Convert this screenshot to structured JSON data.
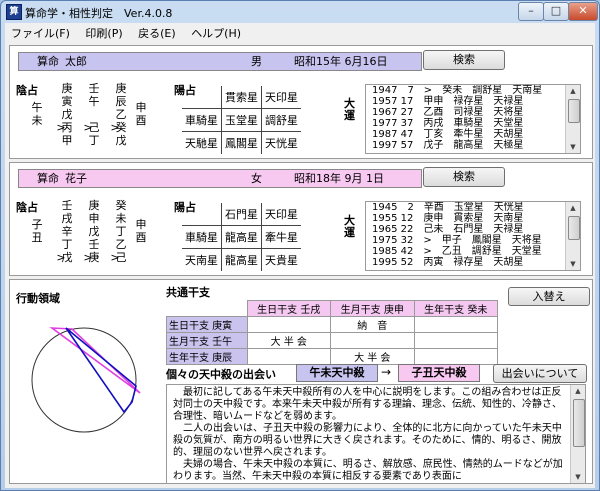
{
  "window": {
    "title": "算命学・相性判定　Ver.4.0.8",
    "icon": "app-icon",
    "controls": {
      "minimize": "–",
      "maximize": "□",
      "close": "✕"
    }
  },
  "menu": [
    "ファイル(F)",
    "印刷(P)",
    "戻る(E)",
    "ヘルプ(H)"
  ],
  "person1": {
    "name_label": "算命",
    "name": "太郎",
    "gender": "男",
    "birth": "昭和15年 6月16日",
    "search_button": "検索",
    "bar_color": "#c8c4f0",
    "inyo_label": "陰占",
    "columns": [
      [
        "庚",
        "寅",
        "戊",
        "丙",
        "甲"
      ],
      [
        "壬",
        "午",
        "",
        "己",
        "丁"
      ],
      [
        "庚",
        "辰",
        "乙",
        "癸",
        "戊"
      ]
    ],
    "left_chars": [
      "午",
      "未"
    ],
    "right_chars": [
      "申",
      "酉"
    ],
    "arrows": [
      ">",
      ">",
      ">"
    ],
    "yosen_label": "陽占",
    "stars": [
      [
        "",
        "貫索星",
        "天印星"
      ],
      [
        "車騎星",
        "玉堂星",
        "調舒星"
      ],
      [
        "天馳星",
        "鳳閣星",
        "天恍星"
      ]
    ],
    "taiun_label": "大運",
    "taiun": [
      "1947　7　>　癸未　調舒星　天南星",
      "1957 17　甲申　禄存星　天禄星",
      "1967 27　乙酉　司禄星　天将星",
      "1977 37　丙戌　車騎星　天堂星",
      "1987 47　丁亥　牽牛星　天胡星",
      "1997 57　戊子　龍高星　天極星"
    ]
  },
  "person2": {
    "name_label": "算命",
    "name": "花子",
    "gender": "女",
    "birth": "昭和18年 9月 1日",
    "search_button": "検索",
    "bar_color": "#f7c8f0",
    "inyo_label": "陰占",
    "columns": [
      [
        "壬",
        "戌",
        "辛",
        "丁",
        "戊"
      ],
      [
        "庚",
        "申",
        "戊",
        "壬",
        "庚"
      ],
      [
        "癸",
        "未",
        "丁",
        "乙",
        "己"
      ]
    ],
    "left_chars": [
      "子",
      "丑"
    ],
    "right_chars": [
      "申",
      "酉"
    ],
    "arrows": [
      ">",
      ">",
      ">"
    ],
    "yosen_label": "陽占",
    "stars": [
      [
        "",
        "石門星",
        "天印星"
      ],
      [
        "車騎星",
        "龍高星",
        "牽牛星"
      ],
      [
        "天南星",
        "龍高星",
        "天貴星"
      ]
    ],
    "taiun_label": "大運",
    "taiun": [
      "1945　2　辛酉　玉堂星　天恍星",
      "1955 12　庚申　貫索星　天南星",
      "1965 22　己未　石門星　天禄星",
      "1975 32　>　甲子　鳳閣星　天将星",
      "1985 42　>　乙丑　調舒星　天堂星",
      "1995 52　丙寅　禄存星　天胡星"
    ]
  },
  "bottom": {
    "kodo_label": "行動領域",
    "kyotsu_label": "共通干支",
    "swap_button": "入替え",
    "table_header": [
      "",
      "生日干支 壬戌",
      "生月干支 庚申",
      "生年干支 癸未"
    ],
    "table_rows": [
      [
        "生日干支 庚寅",
        "",
        "納　音",
        ""
      ],
      [
        "生月干支 壬午",
        "大 半 会",
        "",
        ""
      ],
      [
        "生年干支 庚辰",
        "",
        "大 半 会",
        ""
      ]
    ],
    "tenchu_label": "個々の天中殺の出会い",
    "tenchu_a": "午未天中殺",
    "tenchu_arrow": "→",
    "tenchu_b": "子丑天中殺",
    "tenchu_a_color": "#c8c4f0",
    "tenchu_b_color": "#f7c8f0",
    "about_button": "出会いについて",
    "text": "　最初に記してある午未天中殺所有の人を中心に説明をします。この組み合わせは正反対同士の天中殺です。本来午未天中殺が所有する理論、理念、伝統、知性的、冷静さ、合理性、暗いムードなどを弱めます。\n　二人の出会いは、子丑天中殺の影響力により、全体的に北方に向かっていた午未天中殺の気質が、南方の明るい世界に大きく戻されます。そのために、情的、明るさ、開放的、理屈のない世界へ戻されます。\n　夫婦の場合、午未天中殺の本質に、明るさ、解放感、庶民性、情熱的ムードなどが加わります。当然、午未天中殺の本質に相反する要素であり表面に"
  }
}
